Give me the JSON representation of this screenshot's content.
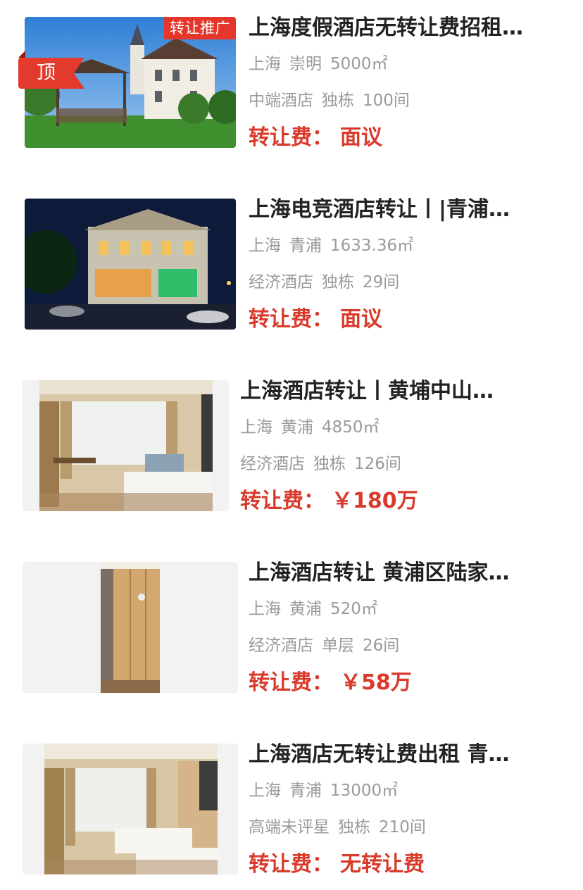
{
  "listings": [
    {
      "title": "上海度假酒店无转让费招租…",
      "city": "上海",
      "district": "崇明",
      "area": "5000㎡",
      "hotel_type": "中端酒店",
      "building": "独栋",
      "rooms": "100间",
      "fee_label": "转让费：",
      "fee_value": "面议",
      "promo_badge": "转让推广",
      "top_badge": "顶"
    },
    {
      "title": "上海电竞酒店转让丨|青浦…",
      "city": "上海",
      "district": "青浦",
      "area": "1633.36㎡",
      "hotel_type": "经济酒店",
      "building": "独栋",
      "rooms": "29间",
      "fee_label": "转让费：",
      "fee_value": "面议"
    },
    {
      "title": "上海酒店转让丨黄埔中山…",
      "city": "上海",
      "district": "黄浦",
      "area": "4850㎡",
      "hotel_type": "经济酒店",
      "building": "独栋",
      "rooms": "126间",
      "fee_label": "转让费：",
      "fee_value": "￥180万"
    },
    {
      "title": "上海酒店转让 黄浦区陆家…",
      "city": "上海",
      "district": "黄浦",
      "area": "520㎡",
      "hotel_type": "经济酒店",
      "building": "单层",
      "rooms": "26间",
      "fee_label": "转让费：",
      "fee_value": "￥58万"
    },
    {
      "title": "上海酒店无转让费出租 青…",
      "city": "上海",
      "district": "青浦",
      "area": "13000㎡",
      "hotel_type": "高端未评星",
      "building": "独栋",
      "rooms": "210间",
      "fee_label": "转让费：",
      "fee_value": "无转让费"
    }
  ],
  "colors": {
    "accent": "#d93a2b",
    "title": "#222222",
    "meta": "#9a9a9a"
  }
}
